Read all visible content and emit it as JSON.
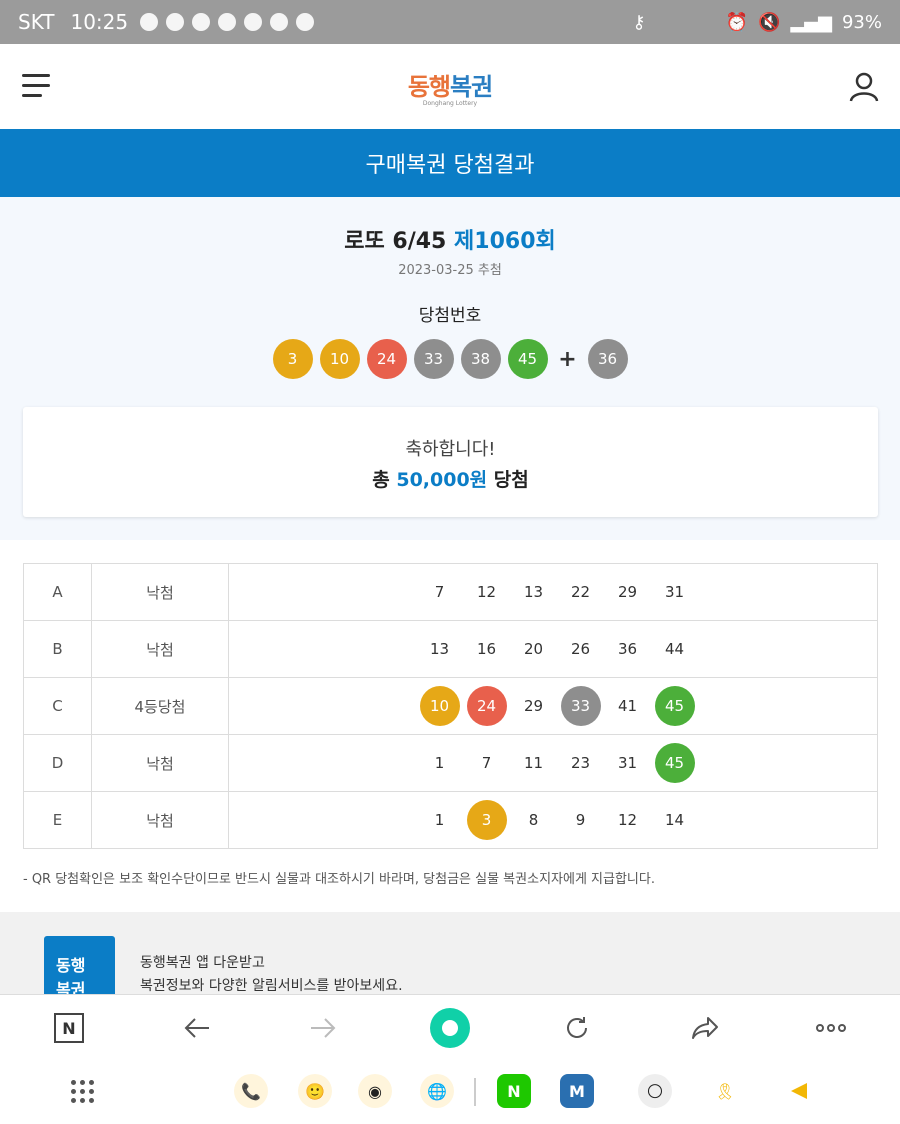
{
  "status_bar": {
    "carrier": "SKT",
    "time": "10:25",
    "battery": "93%"
  },
  "header": {
    "logo_main_a": "동행",
    "logo_main_b": "복권",
    "logo_sub": "Donghang Lottery"
  },
  "banner": {
    "title": "구매복권 당첨결과"
  },
  "draw": {
    "game_name": "로또 6/45",
    "round": "제1060회",
    "date": "2023-03-25 추첨",
    "winning_label": "당첨번호",
    "numbers": [
      "3",
      "10",
      "24",
      "33",
      "38",
      "45"
    ],
    "bonus": "36",
    "number_colors": [
      "#e6a817",
      "#e6a817",
      "#e8604c",
      "#8e8e8e",
      "#8e8e8e",
      "#4caf3a"
    ],
    "bonus_color": "#8e8e8e"
  },
  "result": {
    "congrats": "축하합니다!",
    "total_prefix": "총",
    "total_amount": "50,000원",
    "total_suffix": "당첨"
  },
  "tickets": [
    {
      "game": "A",
      "result": "낙첨",
      "numbers": [
        "7",
        "12",
        "13",
        "22",
        "29",
        "31"
      ]
    },
    {
      "game": "B",
      "result": "낙첨",
      "numbers": [
        "13",
        "16",
        "20",
        "26",
        "36",
        "44"
      ]
    },
    {
      "game": "C",
      "result": "4등당첨",
      "numbers": [
        "10",
        "24",
        "29",
        "33",
        "41",
        "45"
      ]
    },
    {
      "game": "D",
      "result": "낙첨",
      "numbers": [
        "1",
        "7",
        "11",
        "23",
        "31",
        "45"
      ]
    },
    {
      "game": "E",
      "result": "낙첨",
      "numbers": [
        "1",
        "3",
        "8",
        "9",
        "12",
        "14"
      ]
    }
  ],
  "notice": "- QR 당첨확인은 보조 확인수단이므로 반드시 실물과 대조하시기 바라며, 당첨금은 실물 복권소지자에게 지급합니다.",
  "footer": {
    "app_logo_line1": "동행",
    "app_logo_line2": "복권",
    "line1": "동행복권 앱 다운받고",
    "line2": "복권정보와 다양한 알림서비스를 받아보세요."
  },
  "toolbar": {
    "n_label": "N"
  },
  "colors": {
    "brand_blue": "#0b7dc6",
    "yellow": "#e6a817",
    "red": "#e8604c",
    "gray": "#8e8e8e",
    "green": "#4caf3a"
  },
  "icons": [
    "menu-icon",
    "user-icon",
    "back-arrow-icon",
    "forward-arrow-icon",
    "home-icon",
    "refresh-icon",
    "share-icon",
    "more-icon",
    "apps-grid-icon",
    "phone-icon",
    "chat-icon",
    "camera-icon",
    "globe-icon",
    "naver-icon",
    "m-icon",
    "moon-icon",
    "ribbon-icon",
    "triangle-icon"
  ]
}
